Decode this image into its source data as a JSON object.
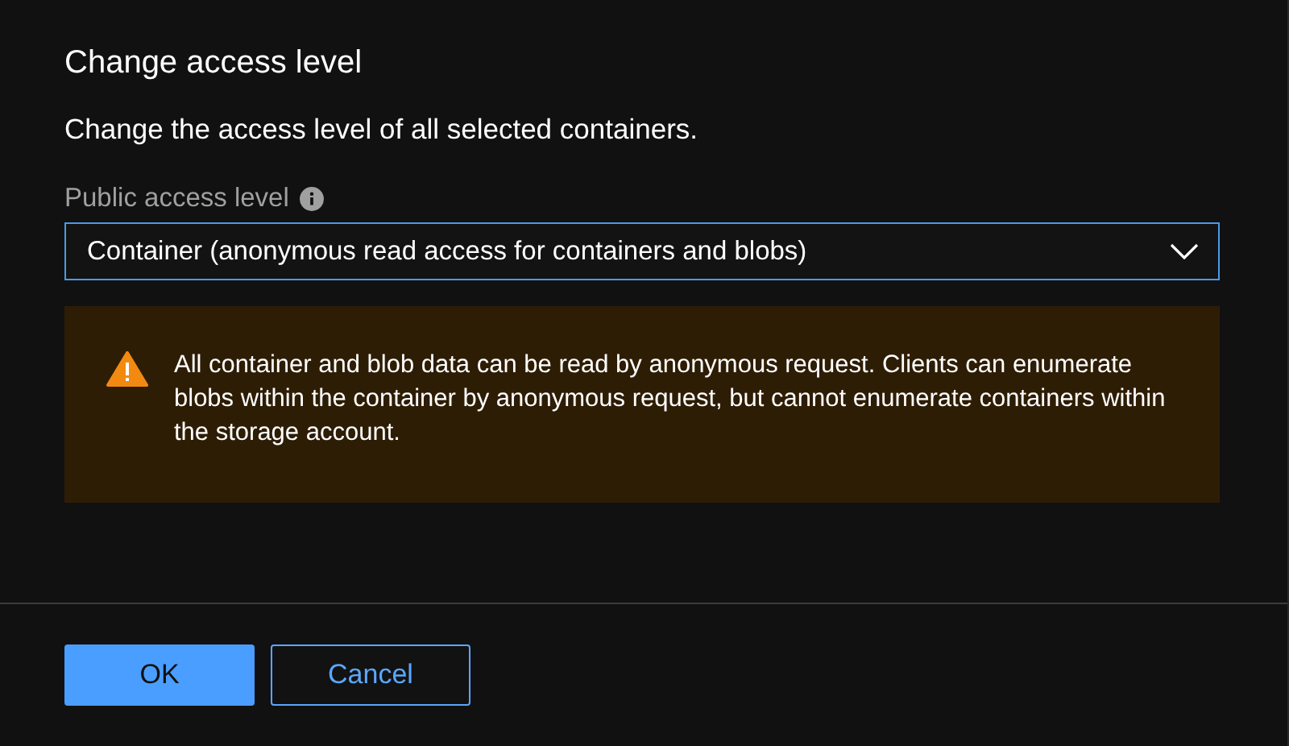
{
  "dialog": {
    "title": "Change access level",
    "description": "Change the access level of all selected containers."
  },
  "field": {
    "label": "Public access level",
    "value": "Container (anonymous read access for containers and blobs)"
  },
  "warning": {
    "text": "All container and blob data can be read by anonymous request. Clients can enumerate blobs within the container by anonymous request, but cannot enumerate containers within the storage account."
  },
  "buttons": [
    {
      "label": "OK",
      "kind": "primary"
    },
    {
      "label": "Cancel",
      "kind": "secondary"
    }
  ]
}
